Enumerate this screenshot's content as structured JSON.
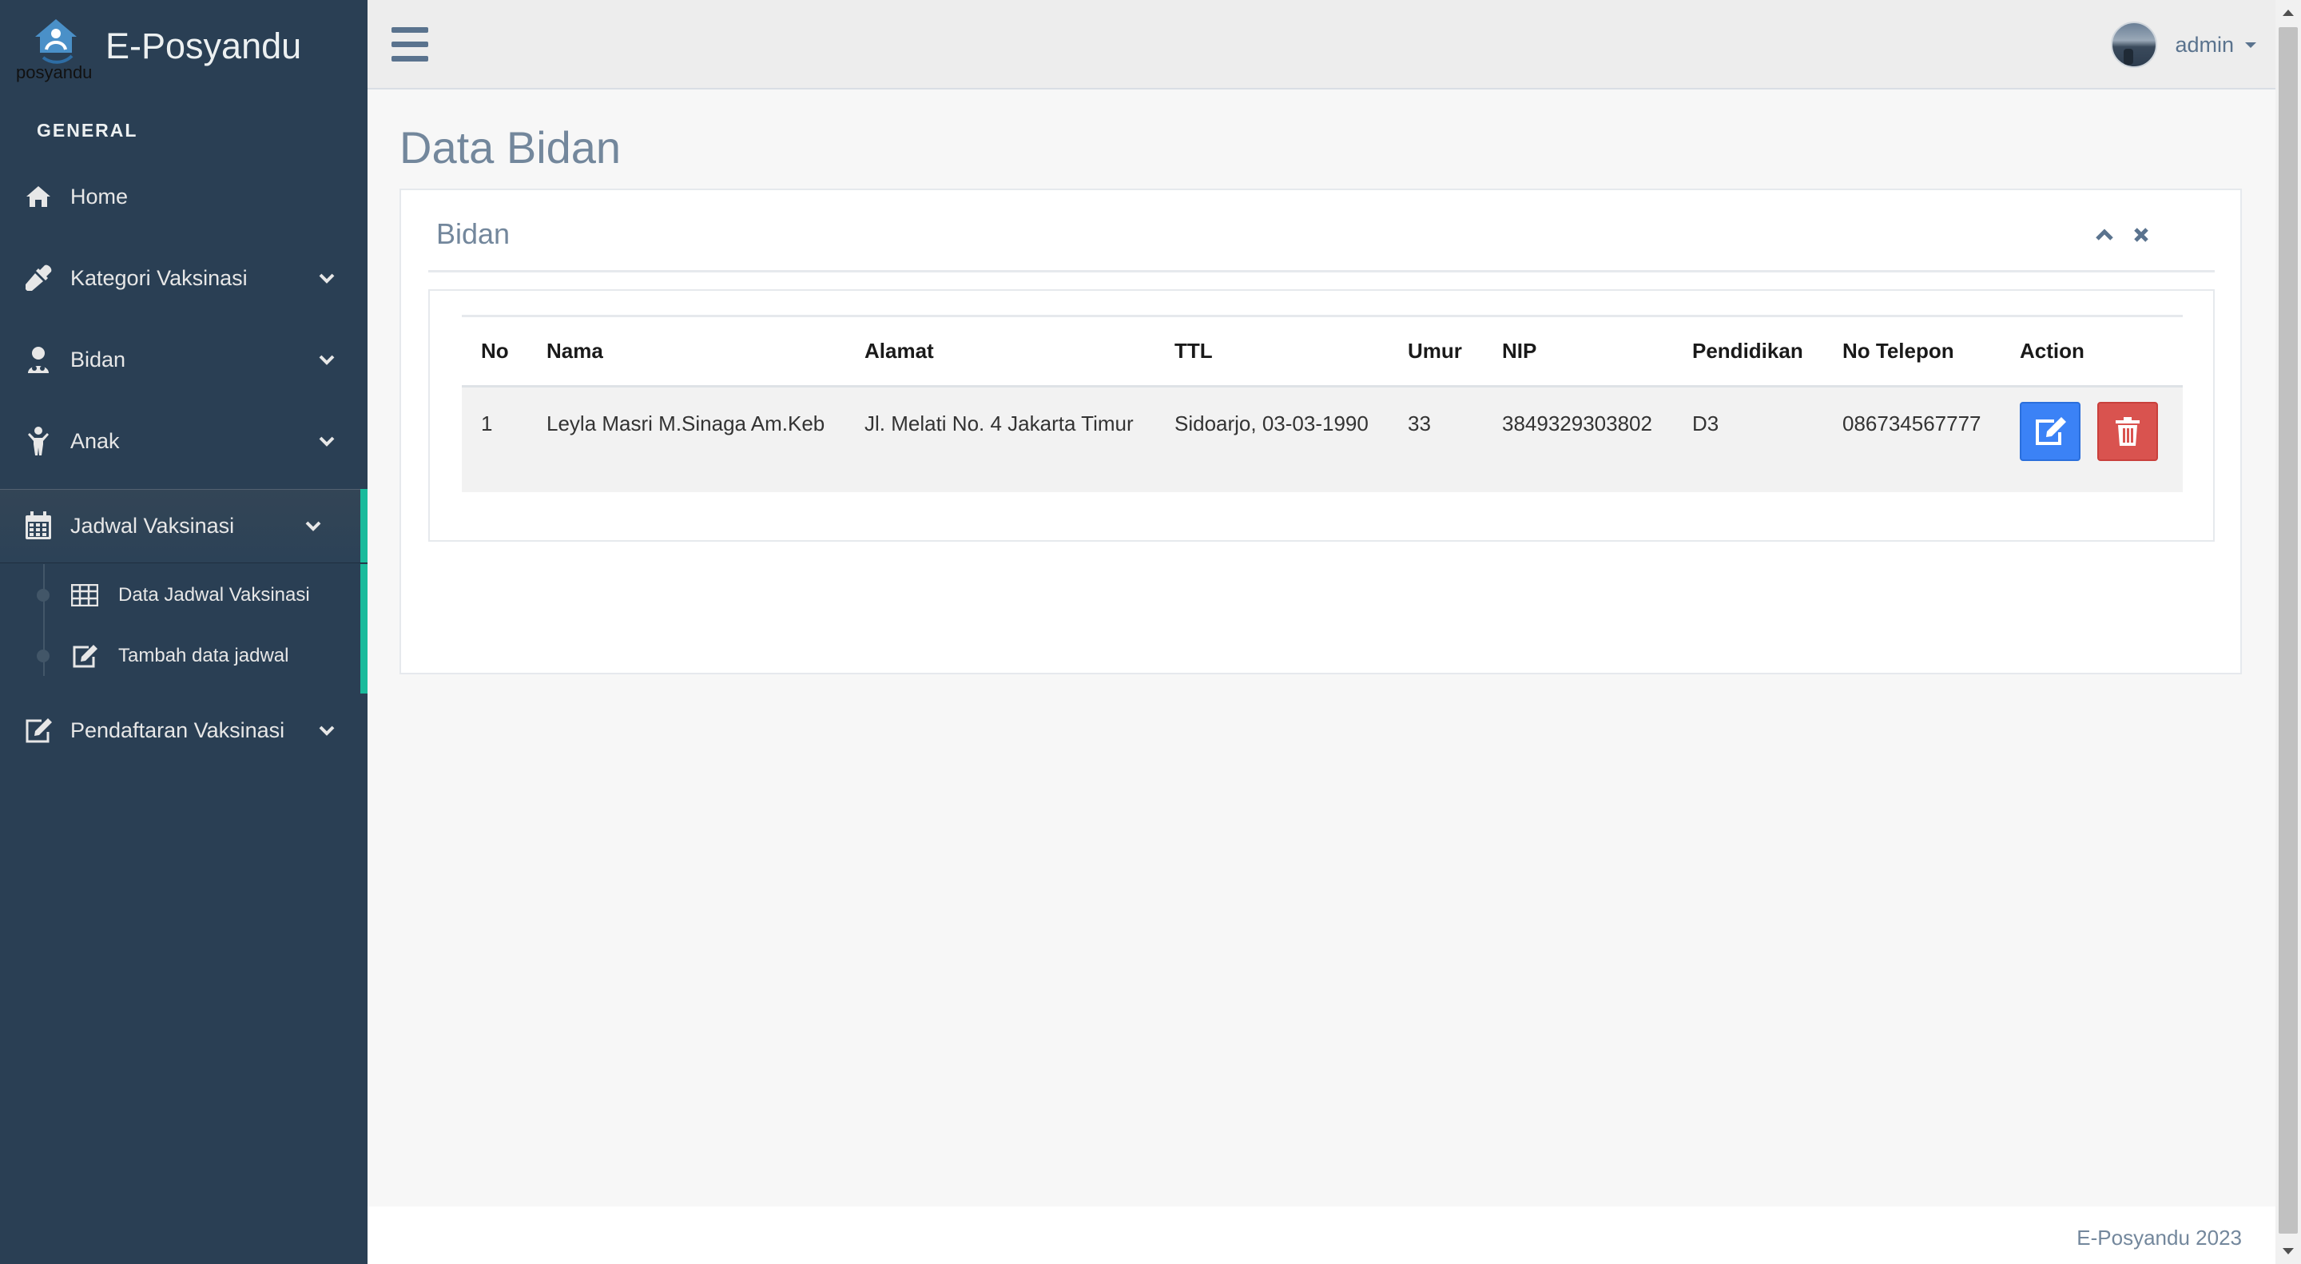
{
  "brand": {
    "logo_text": "posyandu",
    "title": "E-Posyandu"
  },
  "sidebar": {
    "section_title": "GENERAL",
    "items": [
      {
        "label": "Home",
        "icon": "home-icon"
      },
      {
        "label": "Kategori Vaksinasi",
        "icon": "eyedropper-icon"
      },
      {
        "label": "Bidan",
        "icon": "user-md-icon"
      },
      {
        "label": "Anak",
        "icon": "child-icon"
      },
      {
        "label": "Jadwal Vaksinasi",
        "icon": "calendar-icon"
      },
      {
        "label": "Pendaftaran Vaksinasi",
        "icon": "edit-icon"
      }
    ],
    "children": [
      {
        "label": "Data Jadwal Vaksinasi",
        "icon": "table-icon"
      },
      {
        "label": "Tambah data jadwal",
        "icon": "edit-icon"
      }
    ]
  },
  "topnav": {
    "user_name": "admin"
  },
  "main": {
    "page_title": "Data Bidan",
    "panel_title": "Bidan",
    "table": {
      "headers": [
        "No",
        "Nama",
        "Alamat",
        "TTL",
        "Umur",
        "NIP",
        "Pendidikan",
        "No Telepon",
        "Action"
      ],
      "rows": [
        [
          "1",
          "Leyla Masri M.Sinaga Am.Keb",
          "Jl. Melati No. 4 Jakarta Timur",
          "Sidoarjo, 03-03-1990",
          "33",
          "3849329303802",
          "D3",
          "086734567777"
        ]
      ]
    }
  },
  "footer": {
    "text": "E-Posyandu 2023"
  },
  "colors": {
    "sidebar_bg": "#2a3f54",
    "accent": "#1abb9c",
    "edit_button": "#3b82f6",
    "delete_button": "#d9534f"
  }
}
